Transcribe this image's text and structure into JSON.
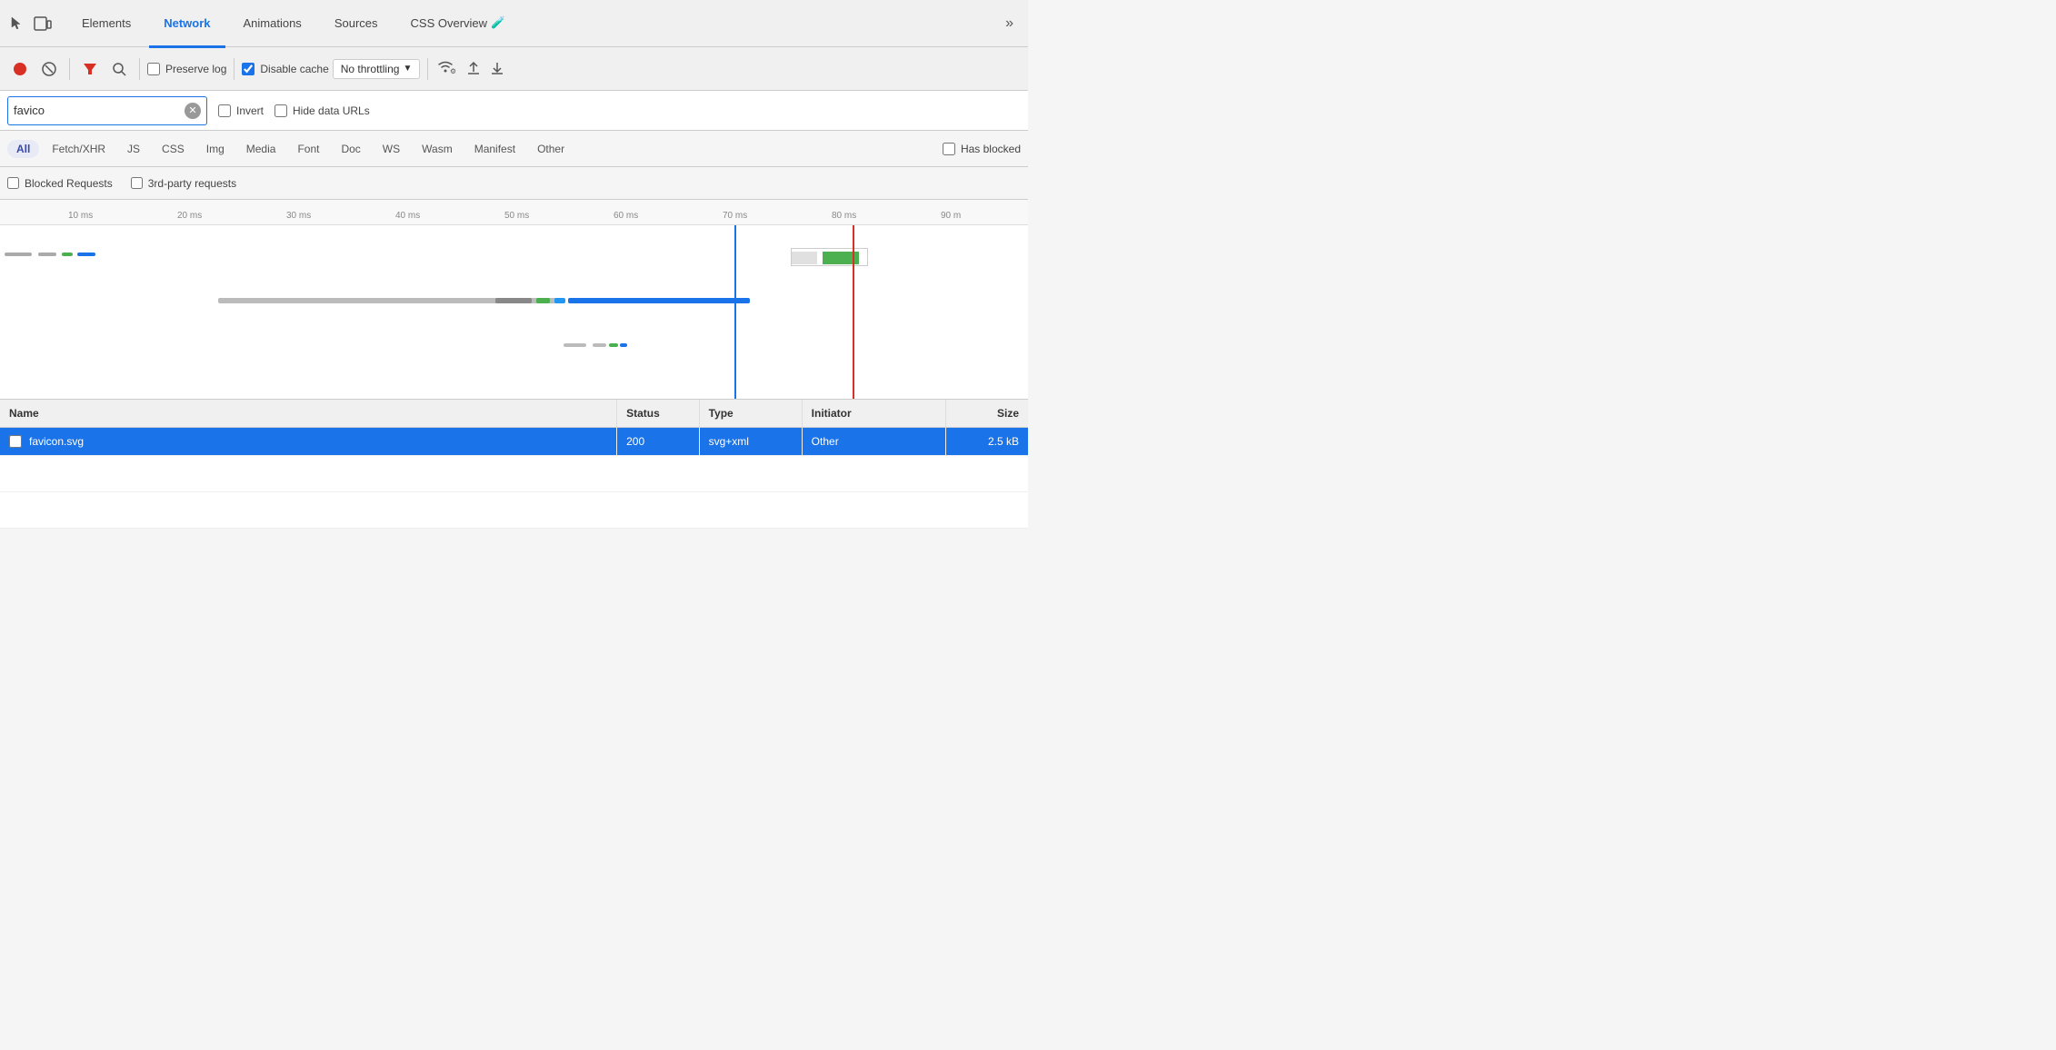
{
  "tabs": [
    {
      "id": "elements",
      "label": "Elements",
      "active": false
    },
    {
      "id": "network",
      "label": "Network",
      "active": true
    },
    {
      "id": "animations",
      "label": "Animations",
      "active": false
    },
    {
      "id": "sources",
      "label": "Sources",
      "active": false
    },
    {
      "id": "css-overview",
      "label": "CSS Overview",
      "active": false
    }
  ],
  "toolbar": {
    "preserve_log_label": "Preserve log",
    "disable_cache_label": "Disable cache",
    "no_throttling_label": "No throttling"
  },
  "filter": {
    "search_value": "favico",
    "search_placeholder": "Filter",
    "invert_label": "Invert",
    "hide_data_urls_label": "Hide data URLs"
  },
  "type_filters": [
    {
      "id": "all",
      "label": "All",
      "active": true
    },
    {
      "id": "fetch-xhr",
      "label": "Fetch/XHR",
      "active": false
    },
    {
      "id": "js",
      "label": "JS",
      "active": false
    },
    {
      "id": "css",
      "label": "CSS",
      "active": false
    },
    {
      "id": "img",
      "label": "Img",
      "active": false
    },
    {
      "id": "media",
      "label": "Media",
      "active": false
    },
    {
      "id": "font",
      "label": "Font",
      "active": false
    },
    {
      "id": "doc",
      "label": "Doc",
      "active": false
    },
    {
      "id": "ws",
      "label": "WS",
      "active": false
    },
    {
      "id": "wasm",
      "label": "Wasm",
      "active": false
    },
    {
      "id": "manifest",
      "label": "Manifest",
      "active": false
    },
    {
      "id": "other",
      "label": "Other",
      "active": false
    }
  ],
  "has_blocked_label": "Has blocked",
  "blocked_requests_label": "Blocked Requests",
  "third_party_requests_label": "3rd-party requests",
  "timeline": {
    "ticks": [
      "10 ms",
      "20 ms",
      "30 ms",
      "40 ms",
      "50 ms",
      "60 ms",
      "70 ms",
      "80 ms",
      "90 m"
    ]
  },
  "table": {
    "columns": [
      "Name",
      "Status",
      "Type",
      "Initiator",
      "Size"
    ],
    "rows": [
      {
        "selected": true,
        "name": "favicon.svg",
        "status": "200",
        "type": "svg+xml",
        "initiator": "Other",
        "size": "2.5 kB"
      }
    ]
  }
}
